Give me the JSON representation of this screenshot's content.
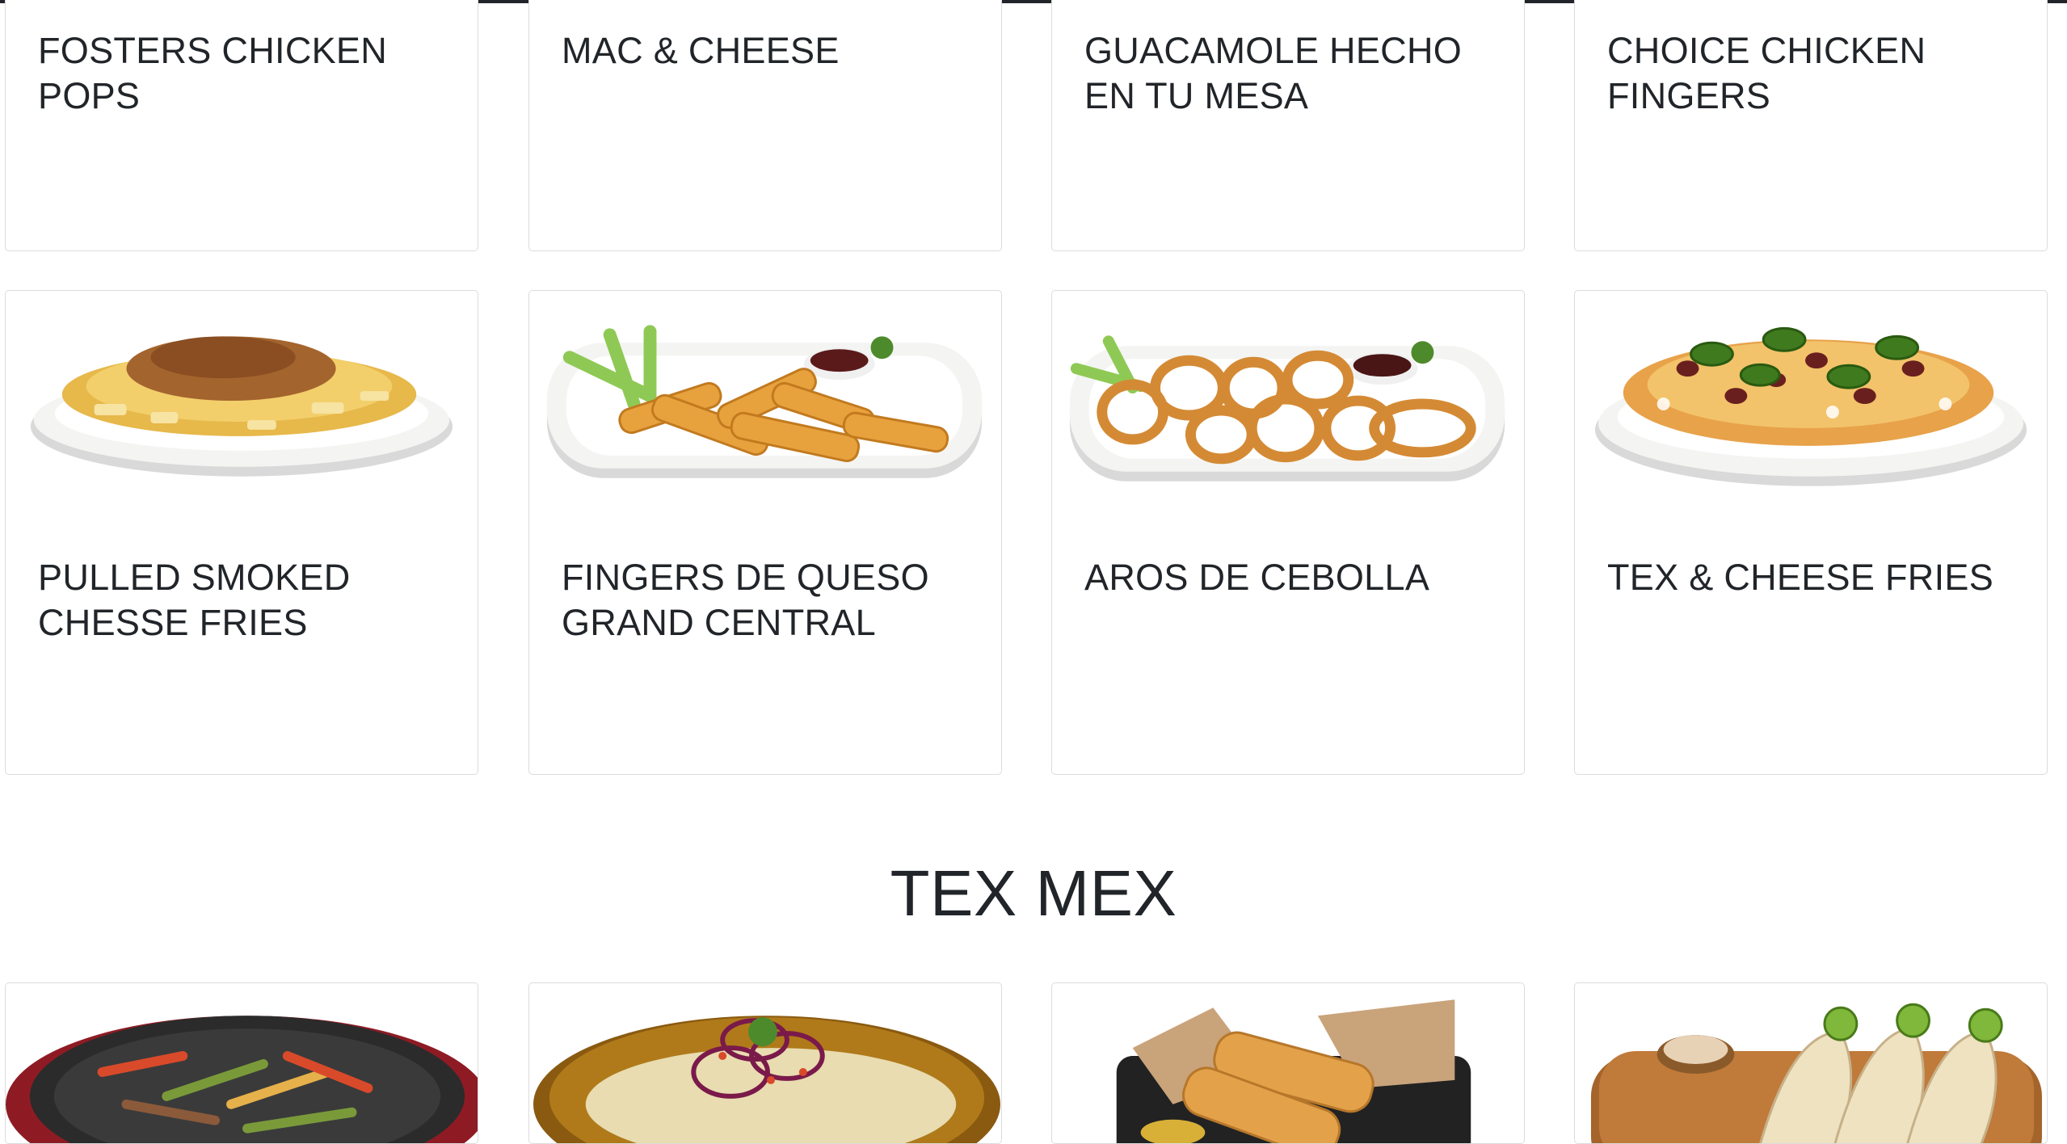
{
  "menu": {
    "row1": [
      {
        "title": "FOSTERS CHICKEN POPS"
      },
      {
        "title": "MAC & CHEESE"
      },
      {
        "title": "GUACAMOLE HECHO EN TU MESA"
      },
      {
        "title": "CHOICE CHICKEN FINGERS"
      }
    ],
    "row2": [
      {
        "title": "PULLED SMOKED CHESSE FRIES",
        "image_icon": "loaded-fries-plate"
      },
      {
        "title": "FINGERS DE QUESO GRAND CENTRAL",
        "image_icon": "cheese-sticks-plate"
      },
      {
        "title": "AROS DE CEBOLLA",
        "image_icon": "onion-rings-plate"
      },
      {
        "title": "TEX & CHEESE FRIES",
        "image_icon": "nacho-fries-plate"
      }
    ],
    "section_title": "TEX MEX",
    "row3": [
      {
        "image_icon": "fajitas-skillet"
      },
      {
        "image_icon": "enchiladas-plate"
      },
      {
        "image_icon": "flautas-basket"
      },
      {
        "image_icon": "tacos-plate"
      }
    ]
  },
  "colors": {
    "text": "#212529",
    "border": "#dcdcdc",
    "background": "#ffffff"
  }
}
